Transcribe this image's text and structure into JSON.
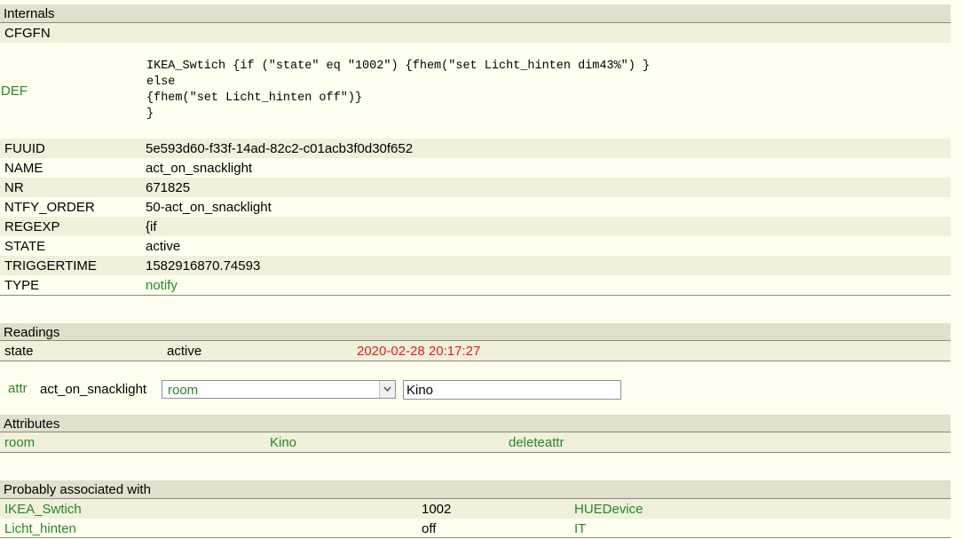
{
  "internals": {
    "title": "Internals",
    "rows": [
      {
        "key": "CFGFN",
        "value": ""
      },
      {
        "key": "DEF",
        "value": "IKEA_Swtich {if (\"state\" eq \"1002\") {fhem(\"set Licht_hinten dim43%\") }\nelse\n{fhem(\"set Licht_hinten off\")}\n}"
      },
      {
        "key": "FUUID",
        "value": "5e593d60-f33f-14ad-82c2-c01acb3f0d30f652"
      },
      {
        "key": "NAME",
        "value": "act_on_snacklight"
      },
      {
        "key": "NR",
        "value": "671825"
      },
      {
        "key": "NTFY_ORDER",
        "value": "50-act_on_snacklight"
      },
      {
        "key": "REGEXP",
        "value": "{if"
      },
      {
        "key": "STATE",
        "value": "active"
      },
      {
        "key": "TRIGGERTIME",
        "value": "1582916870.74593"
      },
      {
        "key": "TYPE",
        "value": "notify"
      }
    ]
  },
  "readings": {
    "title": "Readings",
    "rows": [
      {
        "name": "state",
        "value": "active",
        "time": "2020-02-28 20:17:27"
      }
    ]
  },
  "attr_form": {
    "link": "attr",
    "device": "act_on_snacklight",
    "selected": "room",
    "value": "Kino"
  },
  "attributes": {
    "title": "Attributes",
    "rows": [
      {
        "name": "room",
        "value": "Kino",
        "action": "deleteattr"
      }
    ]
  },
  "associated": {
    "title": "Probably associated with",
    "rows": [
      {
        "name": "IKEA_Swtich",
        "state": "1002",
        "type": "HUEDevice"
      },
      {
        "name": "Licht_hinten",
        "state": "off",
        "type": "IT"
      }
    ]
  },
  "colors": {
    "link": "#278727",
    "timestamp": "#de1f1f",
    "header": "#e0e0cc",
    "odd_row": "#f0f0db",
    "background": "#fffff0"
  },
  "icons": {
    "select_arrow": "chevron-down-icon"
  }
}
